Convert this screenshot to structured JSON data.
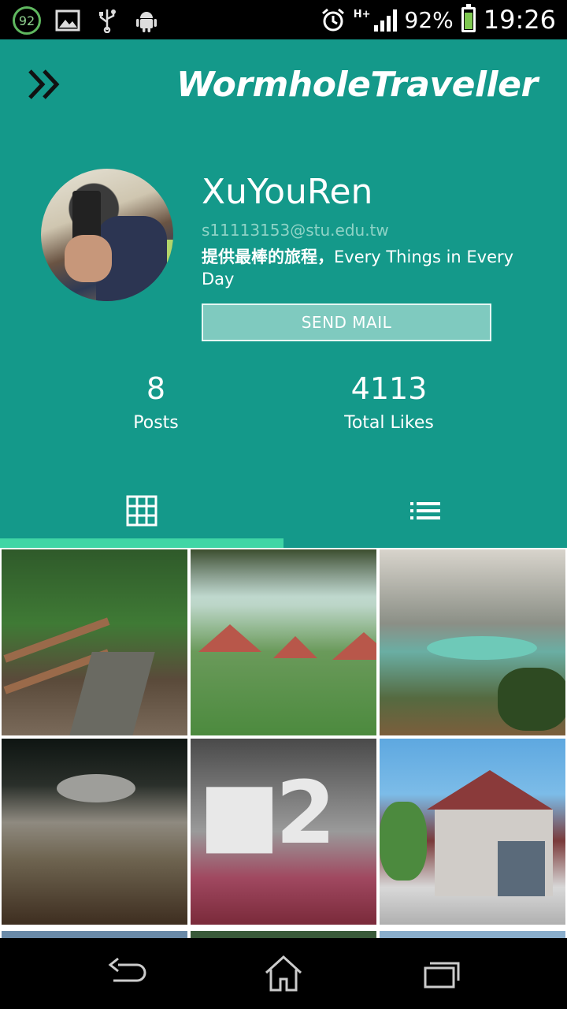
{
  "status_bar": {
    "notification_count": "92",
    "battery_percent": "92%",
    "time": "19:26",
    "network": "H+",
    "icons": [
      "notification-badge-icon",
      "image-icon",
      "usb-icon",
      "android-icon",
      "alarm-icon",
      "signal-icon",
      "battery-charging-icon"
    ]
  },
  "header": {
    "app_title": "WormholeTraveller",
    "menu_icon": "double-chevron-right-icon"
  },
  "profile": {
    "name": "XuYouRen",
    "email": "s11113153@stu.edu.tw",
    "bio_cn": "提供最棒的旅程，",
    "bio_en": "Every Things in Every Day",
    "send_mail_label": "SEND MAIL"
  },
  "stats": {
    "posts_count": "8",
    "posts_label": "Posts",
    "likes_count": "4113",
    "likes_label": "Total Likes"
  },
  "tabs": [
    {
      "icon": "grid-icon",
      "selected": true
    },
    {
      "icon": "list-icon",
      "selected": false
    }
  ],
  "photos": [
    {
      "subject": "forest boardwalk"
    },
    {
      "subject": "garden pavilions"
    },
    {
      "subject": "mud crater lake"
    },
    {
      "subject": "mud volcano bubble"
    },
    {
      "subject": "graffiti wall"
    },
    {
      "subject": "railway museum building"
    }
  ],
  "nav_bar": {
    "icons": [
      "back-icon",
      "home-icon",
      "recent-apps-icon"
    ]
  },
  "colors": {
    "primary": "#14998a",
    "tab_indicator": "#40d6a5",
    "button_fill": "#7fcabf"
  }
}
